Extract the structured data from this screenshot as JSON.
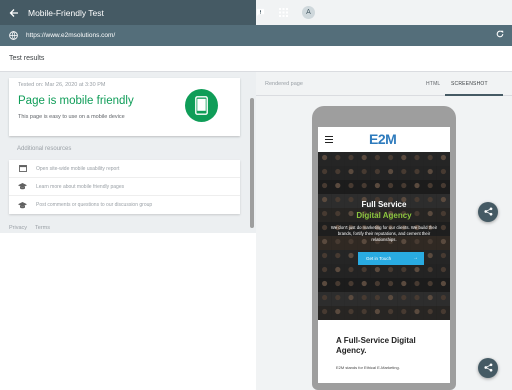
{
  "app": {
    "title": "Mobile-Friendly Test",
    "avatar_letter": "A",
    "bar_color": "#455a64"
  },
  "url_bar": {
    "url": "https://www.e2msolutions.com/"
  },
  "results": {
    "header": "Test results",
    "tested_on": "Tested on: Mar 26, 2020 at 3:30 PM",
    "headline": "Page is mobile friendly",
    "subtitle": "This page is easy to use on a mobile device",
    "status_color": "#0f9d58"
  },
  "additional": {
    "title": "Additional resources",
    "items": [
      {
        "icon": "browser-window-icon",
        "label": "Open site-wide mobile usability report"
      },
      {
        "icon": "graduation-cap-icon",
        "label": "Learn more about mobile friendly pages"
      },
      {
        "icon": "graduation-cap-icon",
        "label": "Post comments or questions to our discussion group"
      }
    ]
  },
  "footer": {
    "privacy": "Privacy",
    "terms": "Terms"
  },
  "rendered": {
    "label": "Rendered page",
    "tabs": [
      "HTML",
      "SCREENSHOT"
    ],
    "active_tab": "SCREENSHOT"
  },
  "site": {
    "logo": "E2M",
    "hero_line1": "Full Service",
    "hero_line2": "Digital Agency",
    "hero_body": "We don't just do marketing for our clients. We build their brands, fortify their reputations, and cement their relationships.",
    "cta": "Get in Touch",
    "cta_arrow": "→",
    "section_heading": "A Full-Service Digital Agency.",
    "section_text": "E2M stands for Ethical E-Marketing.",
    "logo_color": "#2e7bbd",
    "accent_green": "#8cc63f",
    "cta_color": "#29abe2"
  }
}
